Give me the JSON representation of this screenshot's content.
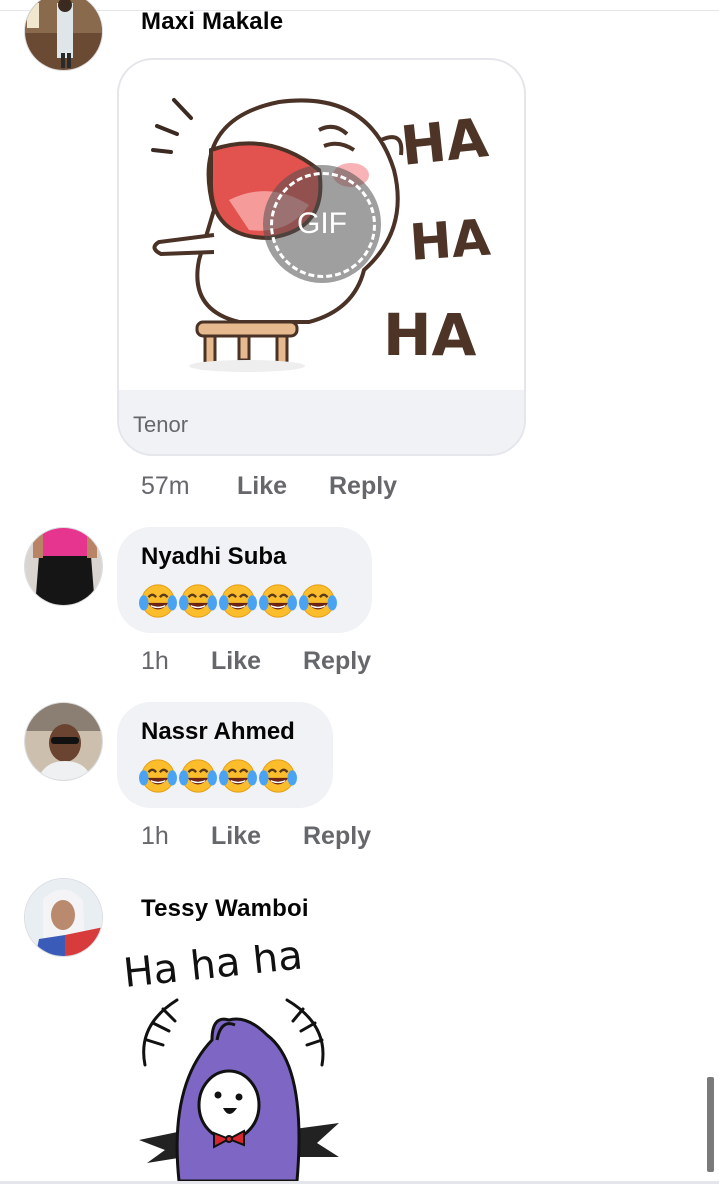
{
  "comments": [
    {
      "author": "Maxi Makale",
      "attachment": {
        "type": "gif",
        "badge": "GIF",
        "source": "Tenor",
        "caption_art": [
          "HA",
          "HA",
          "HA"
        ]
      },
      "time": "57m",
      "like_label": "Like",
      "reply_label": "Reply"
    },
    {
      "author": "Nyadhi Suba",
      "emoji_name": "face-with-tears-of-joy",
      "emoji_count": 5,
      "time": "1h",
      "like_label": "Like",
      "reply_label": "Reply"
    },
    {
      "author": "Nassr Ahmed",
      "emoji_name": "face-with-tears-of-joy",
      "emoji_count": 4,
      "time": "1h",
      "like_label": "Like",
      "reply_label": "Reply"
    },
    {
      "author": "Tessy Wamboi",
      "attachment": {
        "type": "sticker",
        "caption_art": "Ha ha ha"
      }
    }
  ],
  "colors": {
    "bubble": "#f0f2f5",
    "meta_text": "#65676b",
    "sticker_purple": "#7d66c4"
  }
}
